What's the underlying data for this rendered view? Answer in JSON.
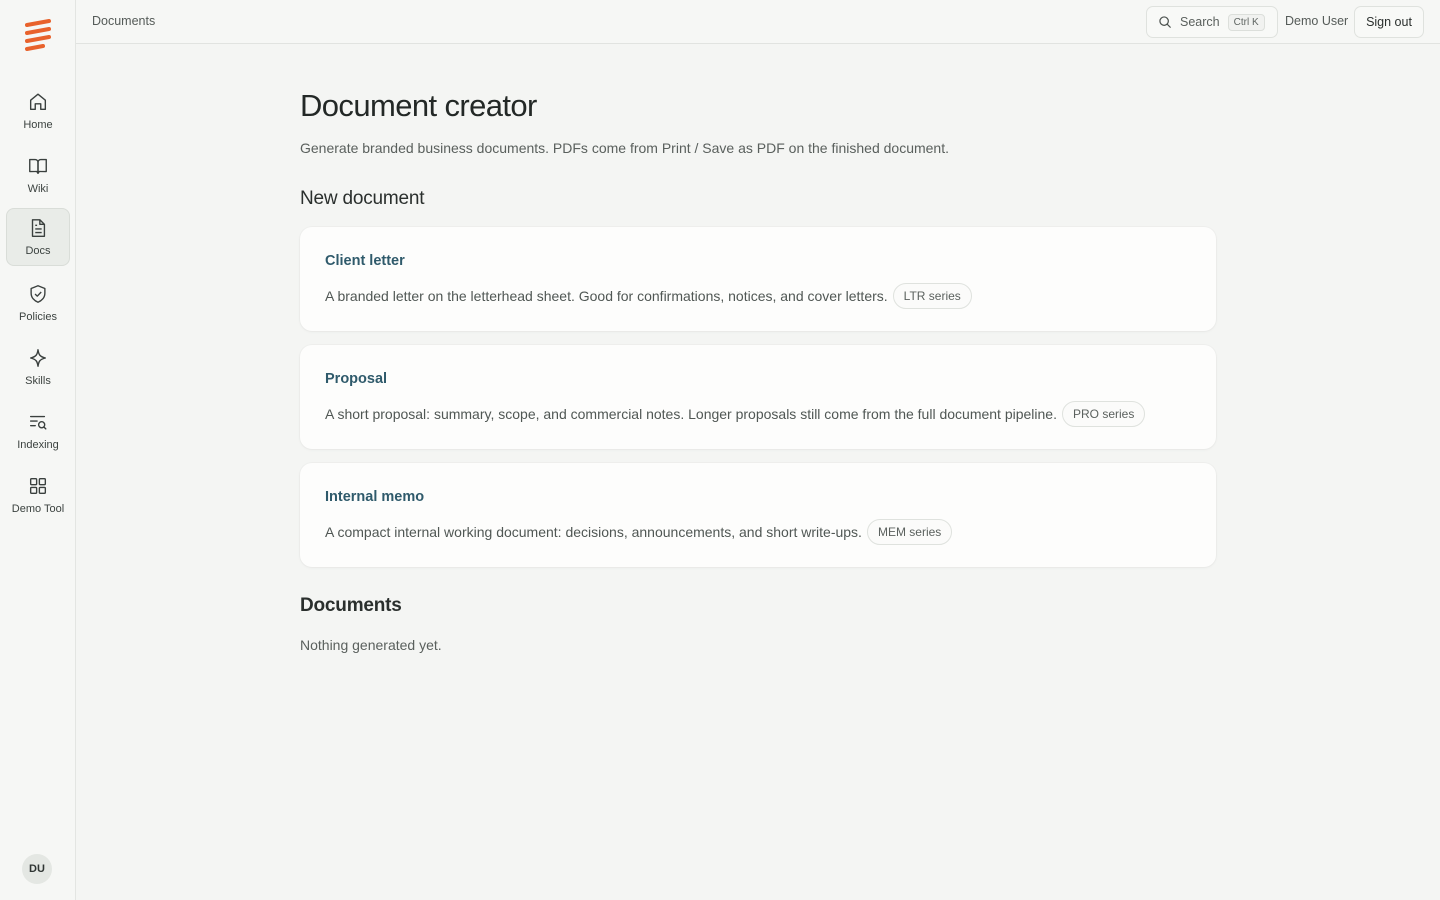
{
  "brand": {
    "accent": "#e8622c"
  },
  "sidebar": {
    "items": [
      {
        "label": "Home",
        "icon": "home-icon"
      },
      {
        "label": "Wiki",
        "icon": "book-icon"
      },
      {
        "label": "Docs",
        "icon": "document-icon",
        "active": true
      },
      {
        "label": "Policies",
        "icon": "shield-icon"
      },
      {
        "label": "Skills",
        "icon": "sparkle-icon"
      },
      {
        "label": "Indexing",
        "icon": "list-search-icon"
      },
      {
        "label": "Demo Tool",
        "icon": "grid-icon"
      }
    ],
    "avatar": "DU"
  },
  "topbar": {
    "breadcrumb": "Documents",
    "search_label": "Search",
    "search_shortcut": "Ctrl K",
    "user_name": "Demo User",
    "signout_label": "Sign out"
  },
  "main": {
    "title": "Document creator",
    "subtitle": "Generate branded business documents. PDFs come from Print / Save as PDF on the finished document.",
    "new_section_title": "New document",
    "templates": [
      {
        "title": "Client letter",
        "description": "A branded letter on the letterhead sheet. Good for confirmations, notices, and cover letters.",
        "badge": "LTR series"
      },
      {
        "title": "Proposal",
        "description": "A short proposal: summary, scope, and commercial notes. Longer proposals still come from the full document pipeline.",
        "badge": "PRO series"
      },
      {
        "title": "Internal memo",
        "description": "A compact internal working document: decisions, announcements, and short write-ups.",
        "badge": "MEM series"
      }
    ],
    "documents_title": "Documents",
    "documents_empty": "Nothing generated yet."
  }
}
